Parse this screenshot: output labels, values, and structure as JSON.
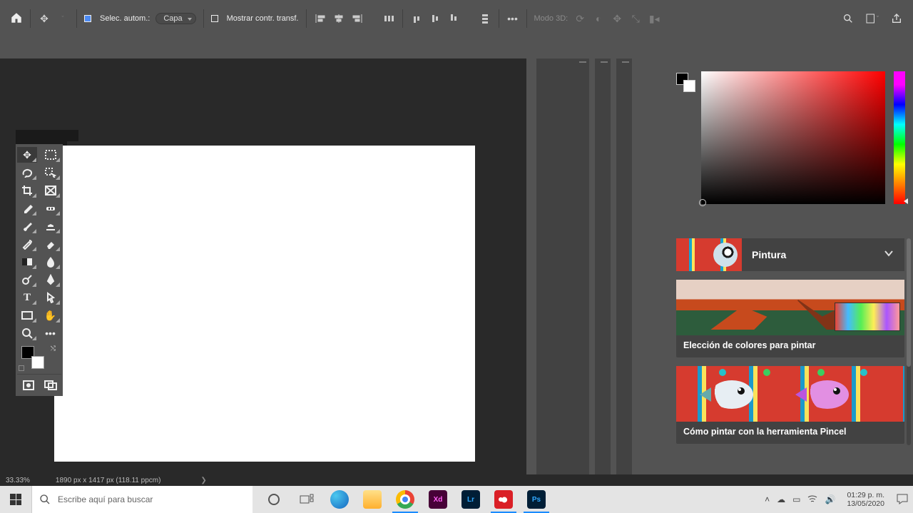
{
  "option_bar": {
    "auto_select_label": "Selec. autom.:",
    "layer_dropdown": "Capa",
    "show_transform_label": "Mostrar contr. transf.",
    "mode3d_label": "Modo 3D:"
  },
  "status": {
    "zoom": "33.33%",
    "doc_dims": "1890 px x 1417 px (118.11 ppcm)"
  },
  "learn_panel": {
    "heading": "Pintura",
    "card1_label": "Elección de colores para pintar",
    "card2_label": "Cómo pintar con la herramienta Pincel"
  },
  "taskbar": {
    "search_placeholder": "Escribe aquí para buscar",
    "time": "01:29 p. m.",
    "date": "13/05/2020",
    "apps": [
      {
        "name": "cortana",
        "bg": "transparent"
      },
      {
        "name": "taskview",
        "bg": "transparent"
      },
      {
        "name": "edge",
        "bg": "linear-gradient(135deg,#36c 0%,#3cba92 100%)",
        "label": ""
      },
      {
        "name": "explorer",
        "bg": "#ffcf48",
        "label": ""
      },
      {
        "name": "chrome",
        "bg": "#fff",
        "label": ""
      },
      {
        "name": "xd",
        "bg": "#470137",
        "label": "Xd"
      },
      {
        "name": "lightroom",
        "bg": "#0f1b2b",
        "label": "Lr"
      },
      {
        "name": "creative-cloud",
        "bg": "#da1f26",
        "label": ""
      },
      {
        "name": "photoshop",
        "bg": "#001e36",
        "label": "Ps"
      }
    ]
  },
  "colors": {
    "canvas_bg": "#282828"
  }
}
